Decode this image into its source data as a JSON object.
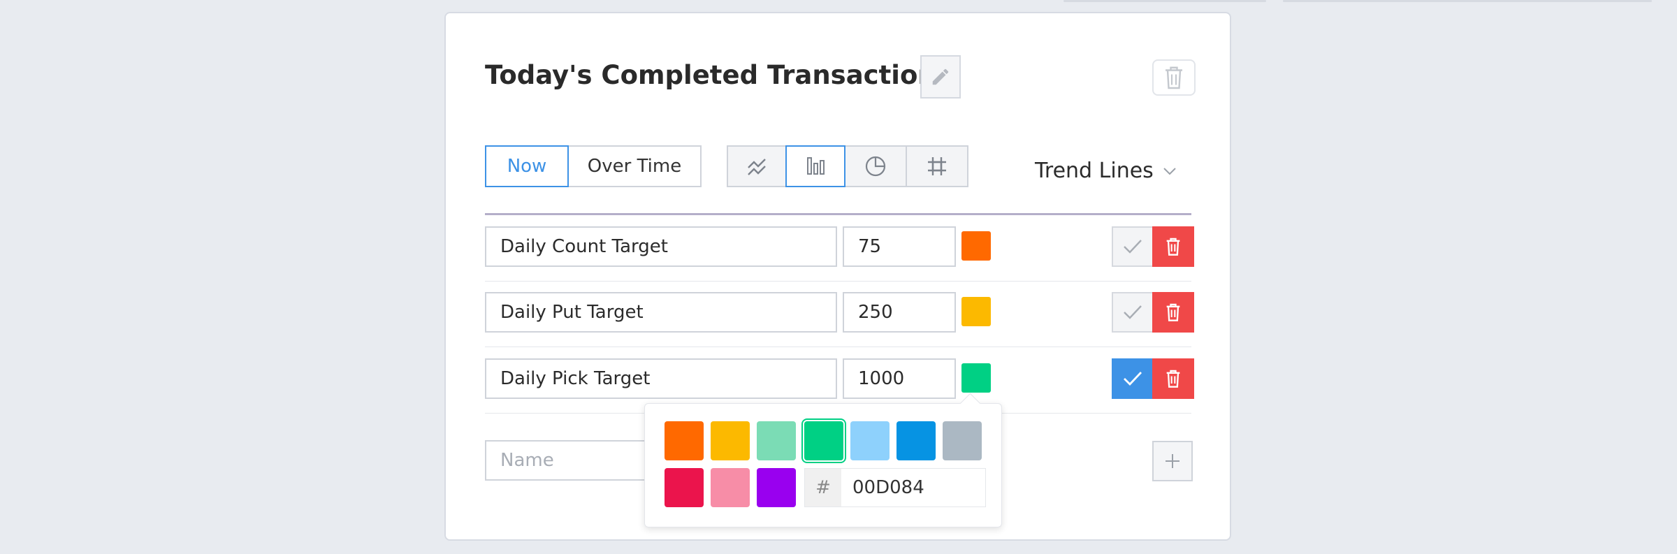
{
  "card": {
    "title": "Today's Completed Transactions",
    "icons": {
      "edit": "pencil-icon",
      "delete": "trash-icon"
    }
  },
  "time_toggle": [
    {
      "label": "Now",
      "active": true
    },
    {
      "label": "Over Time",
      "active": false
    }
  ],
  "chart_types": [
    {
      "icon": "line-chart-icon",
      "active": false
    },
    {
      "icon": "bar-chart-icon",
      "active": true
    },
    {
      "icon": "pie-chart-icon",
      "active": false
    },
    {
      "icon": "grid-icon",
      "active": false
    }
  ],
  "trend_dropdown": {
    "label": "Trend Lines",
    "icon": "chevron-down-icon"
  },
  "trend_lines": [
    {
      "name": "Daily Count Target",
      "value": "75",
      "color": "#FF6900",
      "confirmed": false
    },
    {
      "name": "Daily Put Target",
      "value": "250",
      "color": "#FCB900",
      "confirmed": false
    },
    {
      "name": "Daily Pick Target",
      "value": "1000",
      "color": "#00D084",
      "confirmed": true
    }
  ],
  "new_line": {
    "name_placeholder": "Name",
    "add_icon": "plus-icon"
  },
  "color_picker": {
    "swatches": [
      "#FF6900",
      "#FCB900",
      "#7BDCB5",
      "#00D084",
      "#8ED1FC",
      "#0693E3",
      "#ABB8C3",
      "#EB144C",
      "#F78DA7",
      "#9900EF"
    ],
    "selected": "#00D084",
    "hash_label": "#",
    "hex_value": "00D084"
  }
}
